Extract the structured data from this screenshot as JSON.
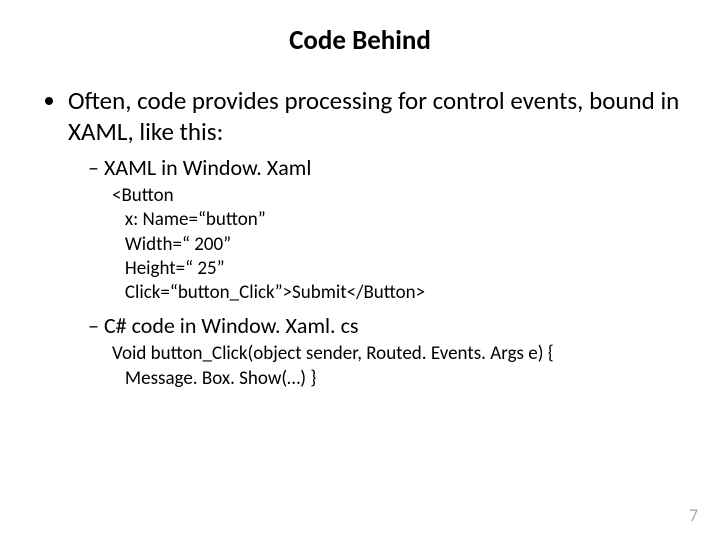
{
  "title": "Code Behind",
  "bullet_main": "Often, code provides processing for control events, bound in XAML, like this:",
  "sub1_label": "XAML in Window. Xaml",
  "code_xaml": "<Button\n   x: Name=“button”\n   Width=“ 200”\n   Height=“ 25”\n   Click=“button_Click”>Submit</Button>",
  "sub2_label": "C# code in Window. Xaml. cs",
  "code_cs": "Void button_Click(object sender, Routed. Events. Args e) {\n   Message. Box. Show(…) }",
  "page_number": "7"
}
